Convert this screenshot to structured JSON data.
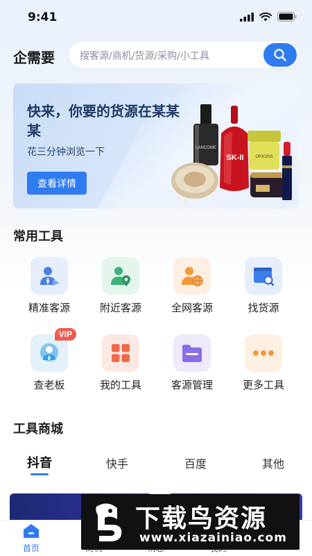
{
  "status_bar": {
    "time": "9:41"
  },
  "header": {
    "title": "企需要",
    "search_placeholder": "搜客源/商机/货源/采购/小工具"
  },
  "banner": {
    "title": "快来，你要的货源在某某某",
    "subtitle": "花三分钟浏览一下",
    "button_label": "查看详情",
    "product_brands": [
      "LANCOME",
      "SK-II",
      "ORIGINS"
    ]
  },
  "common_tools": {
    "title": "常用工具",
    "items": [
      {
        "label": "精准客源",
        "icon": "person-target-icon",
        "color": "#4a7fe0"
      },
      {
        "label": "附近客源",
        "icon": "person-location-icon",
        "color": "#3fb07a"
      },
      {
        "label": "全网客源",
        "icon": "person-globe-icon",
        "color": "#f29a3a"
      },
      {
        "label": "找货源",
        "icon": "window-search-icon",
        "color": "#3d7ee8"
      },
      {
        "label": "查老板",
        "icon": "boss-icon",
        "color": "#2f9fe8",
        "badge": "VIP"
      },
      {
        "label": "我的工具",
        "icon": "grid-icon",
        "color": "#f06a4a"
      },
      {
        "label": "客源管理",
        "icon": "folder-icon",
        "color": "#8a6de8"
      },
      {
        "label": "更多工具",
        "icon": "more-icon",
        "color": "#f29a3a"
      }
    ]
  },
  "tool_mall": {
    "title": "工具商城",
    "tabs": [
      {
        "label": "抖音",
        "active": true
      },
      {
        "label": "快手",
        "active": false
      },
      {
        "label": "百度",
        "active": false
      },
      {
        "label": "其他",
        "active": false
      }
    ]
  },
  "bottom_nav": {
    "items": [
      {
        "label": "首页",
        "active": true
      },
      {
        "label": "商机",
        "active": false
      },
      {
        "label": "消息",
        "active": false
      },
      {
        "label": "我的",
        "active": false
      }
    ]
  },
  "watermark": {
    "title": "下载鸟资源",
    "url": "www.xiazainiao.com"
  },
  "colors": {
    "accent": "#2f7bf0",
    "vip": "#f05a52"
  }
}
